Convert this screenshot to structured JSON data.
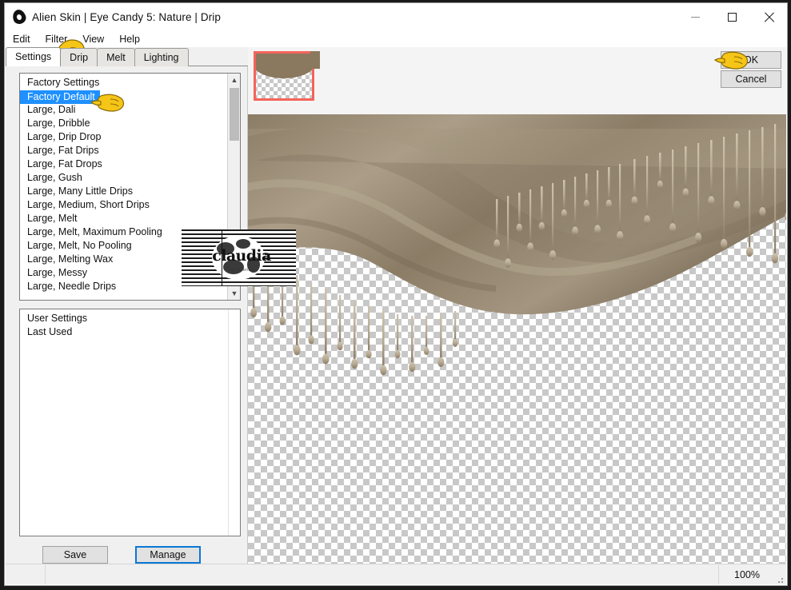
{
  "window": {
    "title": "Alien Skin | Eye Candy 5: Nature | Drip",
    "app_icon": "alien-eye-icon",
    "controls": {
      "minimize": "minimize-icon",
      "maximize": "maximize-icon",
      "close": "close-icon"
    }
  },
  "menubar": {
    "items": [
      "Edit",
      "Filter",
      "View",
      "Help"
    ]
  },
  "tabs": [
    {
      "label": "Settings",
      "active": true
    },
    {
      "label": "Drip",
      "active": false
    },
    {
      "label": "Melt",
      "active": false
    },
    {
      "label": "Lighting",
      "active": false
    }
  ],
  "settings_list": {
    "group_header": "Factory Settings",
    "selected": "Factory Default",
    "items": [
      "Factory Settings",
      "Factory Default",
      "Large, Dali",
      "Large, Dribble",
      "Large, Drip Drop",
      "Large, Fat Drips",
      "Large, Fat Drops",
      "Large, Gush",
      "Large, Many Little Drips",
      "Large, Medium, Short Drips",
      "Large, Melt",
      "Large, Melt, Maximum Pooling",
      "Large, Melt, No Pooling",
      "Large, Melting Wax",
      "Large, Messy",
      "Large, Needle Drips"
    ],
    "scroll_up": "chevron-up-icon",
    "scroll_down": "chevron-down-icon"
  },
  "user_list": {
    "items": [
      "User Settings",
      "Last Used"
    ]
  },
  "buttons": {
    "save": "Save",
    "manage": "Manage",
    "ok": "OK",
    "cancel": "Cancel"
  },
  "preview": {
    "thumbnail_name": "navigator-thumbnail",
    "tools": [
      {
        "name": "compare-preview-icon",
        "active": false
      },
      {
        "name": "hand-pan-icon",
        "active": true
      },
      {
        "name": "zoom-magnifier-icon",
        "active": false
      }
    ]
  },
  "watermark": {
    "text": "claudia",
    "subtext": "psp tutorials"
  },
  "statusbar": {
    "zoom": "100%"
  },
  "colors": {
    "selection_blue": "#1e90ff",
    "focus_blue": "#0a78d4",
    "thumb_outline_red": "#f4645a",
    "drip_tan": "#8d7c64",
    "panel_gray": "#f0f0f0",
    "pointer_yellow": "#f5c518"
  }
}
